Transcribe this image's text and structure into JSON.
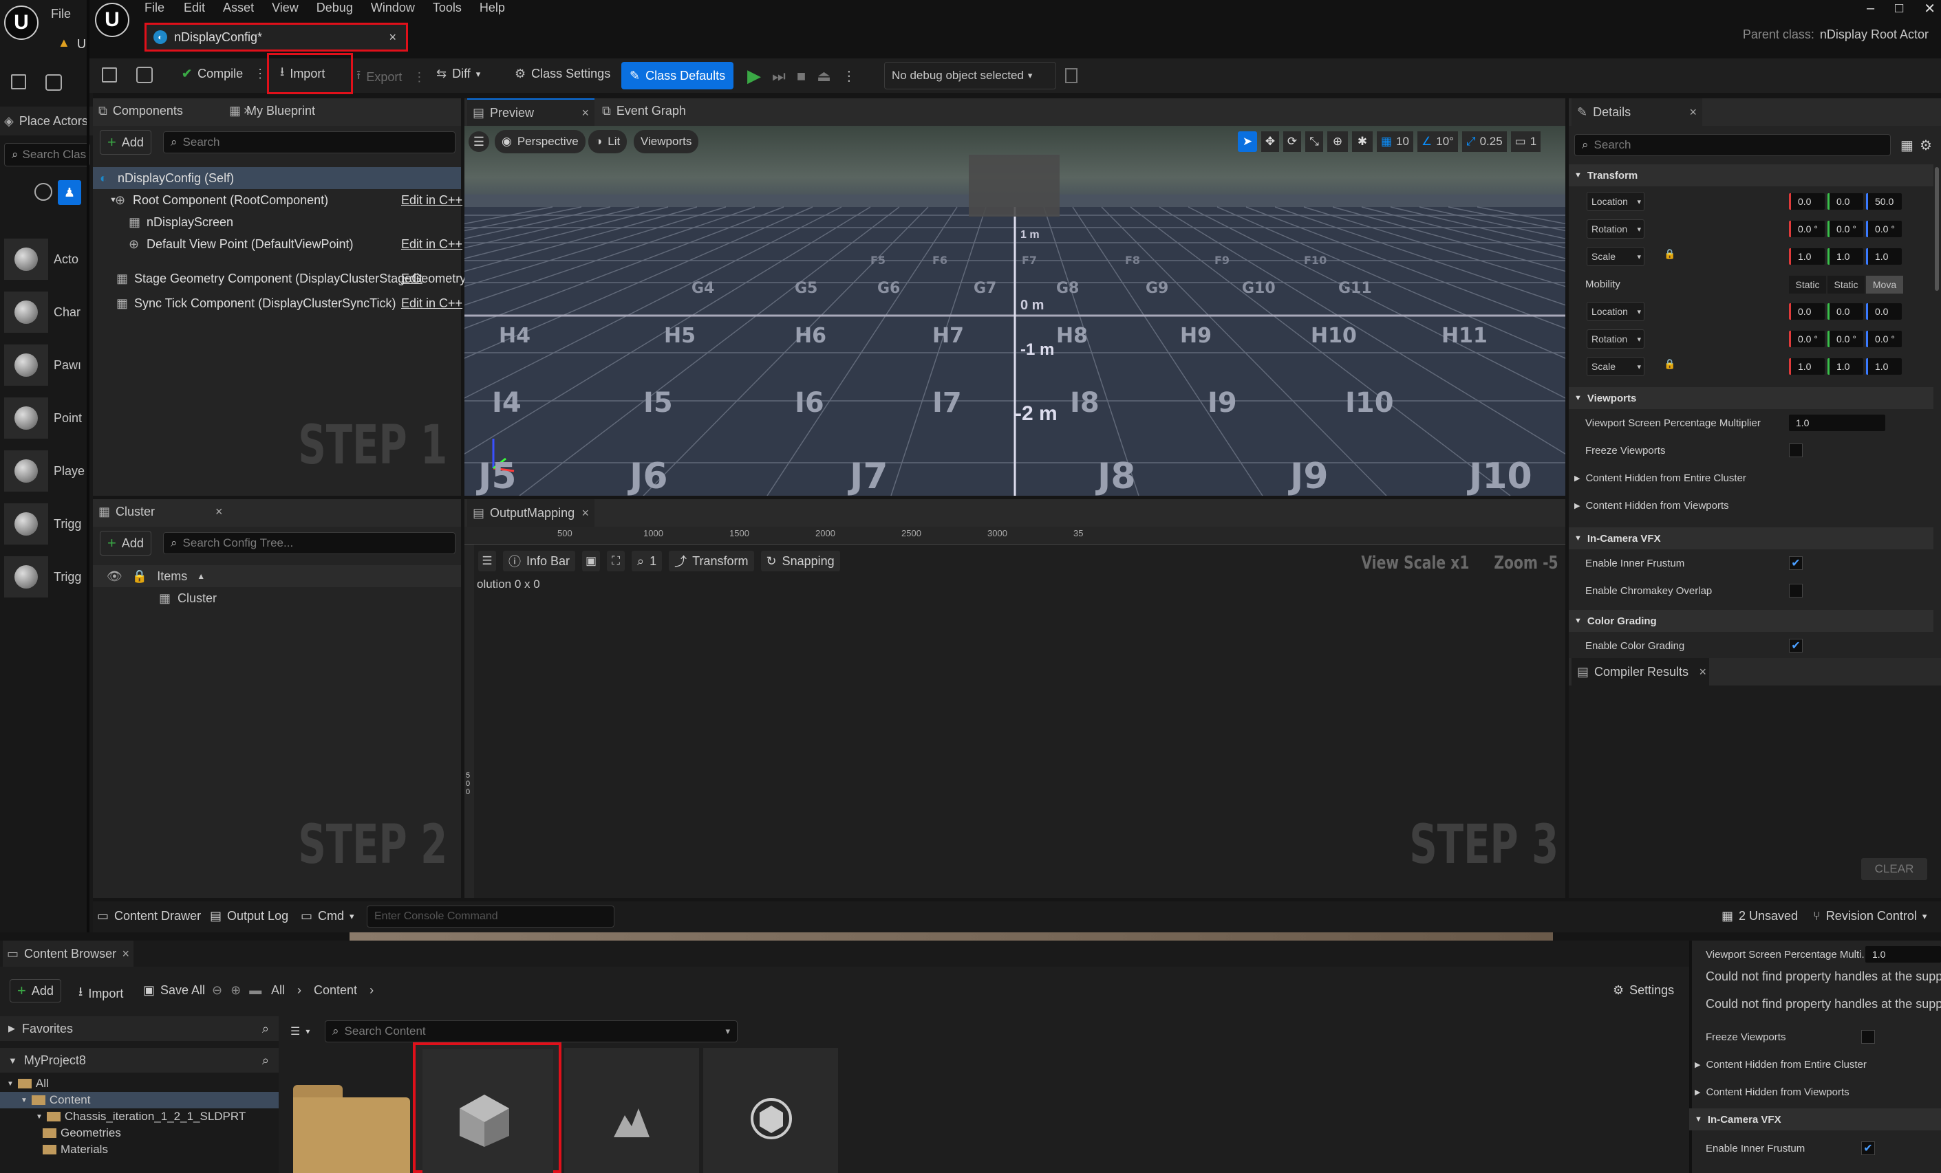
{
  "outer": {
    "menu_file": "File",
    "u_label": "U",
    "place_actors": "Place Actors",
    "search_placeholder": "Search Clas",
    "items": [
      {
        "label": "Acto"
      },
      {
        "label": "Char"
      },
      {
        "label": "Pawı"
      },
      {
        "label": "Point"
      },
      {
        "label": "Playe"
      },
      {
        "label": "Trigg"
      },
      {
        "label": "Trigg"
      }
    ]
  },
  "menu": [
    "File",
    "Edit",
    "Asset",
    "View",
    "Debug",
    "Window",
    "Tools",
    "Help"
  ],
  "title": {
    "tab": "nDisplayConfig*",
    "close": "×",
    "parent_prefix": "Parent class:",
    "parent_class": "nDisplay Root Actor",
    "win_min": "–",
    "win_max": "□",
    "win_close": "✕"
  },
  "toolbar": {
    "compile": "Compile",
    "import": "Import",
    "export": "Export",
    "diff": "Diff",
    "class_settings": "Class Settings",
    "class_defaults": "Class Defaults",
    "debug_select": "No debug object selected"
  },
  "components": {
    "tab": "Components",
    "tab2": "My Blueprint",
    "add": "Add",
    "search_placeholder": "Search",
    "edit_cpp": "Edit in C++",
    "tree": [
      {
        "label": "nDisplayConfig (Self)",
        "edit": ""
      },
      {
        "label": "Root Component (RootComponent)",
        "edit": "Edit in C++"
      },
      {
        "label": "nDisplayScreen",
        "edit": ""
      },
      {
        "label": "Default View Point (DefaultViewPoint)",
        "edit": "Edit in C++"
      },
      {
        "label": "Stage Geometry Component (DisplayClusterStageGeometry)",
        "edit": "Edit"
      },
      {
        "label": "Sync Tick Component (DisplayClusterSyncTick)",
        "edit": "Edit in C++"
      }
    ],
    "step": "STEP 1"
  },
  "cluster": {
    "tab": "Cluster",
    "add": "Add",
    "search_placeholder": "Search Config Tree...",
    "items_header": "Items",
    "item": "Cluster",
    "step": "STEP 2"
  },
  "preview": {
    "tab": "Preview",
    "tab2": "Event Graph",
    "perspective": "Perspective",
    "lit": "Lit",
    "viewports": "Viewports",
    "grid": "10",
    "angle": "10°",
    "scale": "0.25",
    "cam": "1",
    "rowH": [
      "H4",
      "H5",
      "H6",
      "H7",
      "H8",
      "H9",
      "H10",
      "H11"
    ],
    "rowI": [
      "I4",
      "I5",
      "I6",
      "I7",
      "I8",
      "I9",
      "I10"
    ],
    "rowJ": [
      "J5",
      "J6",
      "J7",
      "J8",
      "J9",
      "J10"
    ],
    "rowG": [
      "G4",
      "G5",
      "G6",
      "G7",
      "G8",
      "G9",
      "G10",
      "G11"
    ],
    "rowF": [
      "F5",
      "F6",
      "F7",
      "F8",
      "F9",
      "F10"
    ],
    "m1": "-1 m",
    "m2": "-2 m",
    "m0": "0 m",
    "mtop": "1 m"
  },
  "output": {
    "tab": "OutputMapping",
    "ruler": [
      "500",
      "1000",
      "1500",
      "2000",
      "2500",
      "3000",
      "35"
    ],
    "info_bar": "Info Bar",
    "zoom_num": "1",
    "transform": "Transform",
    "snapping": "Snapping",
    "view_scale": "View Scale x1",
    "zoom": "Zoom -5",
    "resolution": "olution 0 x 0",
    "step": "STEP 3",
    "vruler": "500"
  },
  "details": {
    "tab": "Details",
    "search_placeholder": "Search",
    "transform": "Transform",
    "location": "Location",
    "rotation": "Rotation",
    "scale": "Scale",
    "loc": [
      "0.0",
      "0.0",
      "50.0"
    ],
    "rot": [
      "0.0 °",
      "0.0 °",
      "0.0 °"
    ],
    "scl": [
      "1.0",
      "1.0",
      "1.0"
    ],
    "mobility": "Mobility",
    "mob_opts": [
      "Static",
      "Static",
      "Mova"
    ],
    "loc2": [
      "0.0",
      "0.0",
      "0.0"
    ],
    "rot2": [
      "0.0 °",
      "0.0 °",
      "0.0 °"
    ],
    "scl2": [
      "1.0",
      "1.0",
      "1.0"
    ],
    "viewports": "Viewports",
    "vspm": "Viewport Screen Percentage Multiplier",
    "vspm_val": "1.0",
    "freeze": "Freeze Viewports",
    "hidden_cluster": "Content Hidden from Entire Cluster",
    "hidden_viewports": "Content Hidden from Viewports",
    "icvfx": "In-Camera VFX",
    "inner_frustum": "Enable Inner Frustum",
    "chroma": "Enable Chromakey Overlap",
    "color_grading": "Color Grading",
    "enable_cg": "Enable Color Grading"
  },
  "compiler": {
    "tab": "Compiler Results",
    "clear": "CLEAR"
  },
  "statusbar": {
    "content_drawer": "Content Drawer",
    "output_log": "Output Log",
    "cmd": "Cmd",
    "console_placeholder": "Enter Console Command",
    "unsaved": "2 Unsaved",
    "revision": "Revision Control"
  },
  "content": {
    "tab": "Content Browser",
    "add": "Add",
    "import": "Import",
    "save_all": "Save All",
    "crumb_all": "All",
    "crumb_content": "Content",
    "settings": "Settings",
    "favorites": "Favorites",
    "project": "MyProject8",
    "search_placeholder": "Search Content",
    "tree": [
      {
        "label": "All"
      },
      {
        "label": "Content"
      },
      {
        "label": "Chassis_iteration_1_2_1_SLDPRT"
      },
      {
        "label": "Geometries"
      },
      {
        "label": "Materials"
      }
    ]
  },
  "right_lower": {
    "vspm": "Viewport Screen Percentage Multi...",
    "vspm_val": "1.0",
    "err1": "Could not find property handles at the supplied p",
    "err2": "Could not find property handles at the supplied p",
    "freeze": "Freeze Viewports",
    "hidden_cluster": "Content Hidden from Entire Cluster",
    "hidden_viewports": "Content Hidden from Viewports",
    "icvfx": "In-Camera VFX",
    "inner_frustum": "Enable Inner Frustum"
  },
  "colors": {
    "accent": "#0a70e0",
    "highlight": "#e0101a",
    "green": "#3aa845",
    "bg": "#151515",
    "panel": "#242424"
  }
}
